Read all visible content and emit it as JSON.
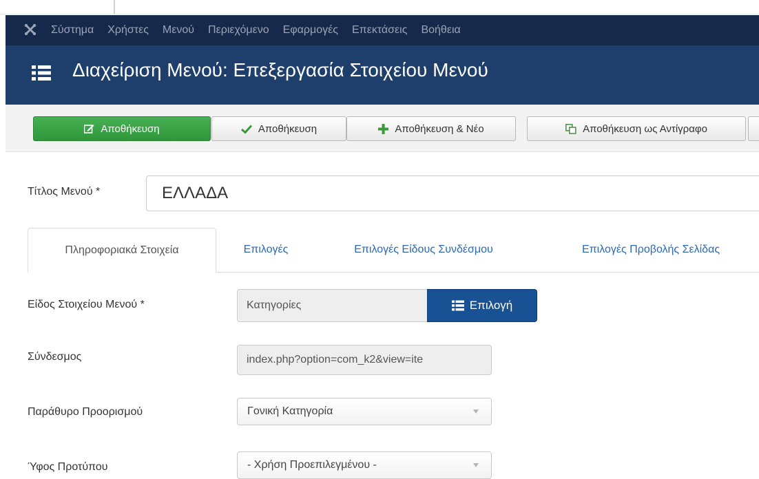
{
  "nav": {
    "logo_icon": "joomla-icon",
    "items": [
      "Σύστημα",
      "Χρήστες",
      "Μενού",
      "Περιεχόμενο",
      "Εφαρμογές",
      "Επεκτάσεις",
      "Βοήθεια"
    ]
  },
  "header": {
    "icon": "list-icon",
    "title": "Διαχείριση Μενού: Επεξεργασία Στοιχείου Μενού"
  },
  "toolbar": {
    "save_label": "Αποθήκευση",
    "save_close_label": "Αποθήκευση",
    "save_new_label": "Αποθήκευση & Νέο",
    "save_copy_label": "Αποθήκευση ως Αντίγραφο"
  },
  "form": {
    "title_label": "Τίτλος Μενού *",
    "title_value": "ΕΛΛΑΔΑ",
    "tabs": [
      "Πληροφοριακά Στοιχεία",
      "Επιλογές",
      "Επιλογές Είδους Συνδέσμου",
      "Επιλογές Προβολής Σελίδας"
    ],
    "active_tab": "Πληροφοριακά Στοιχεία",
    "item_type_label": "Είδος Στοιχείου Μενού *",
    "item_type_value": "Κατηγορίες",
    "select_label": "Επιλογή",
    "link_label": "Σύνδεσμος",
    "link_value": "index.php?option=com_k2&view=ite",
    "target_label": "Παράθυρο Προορισμού",
    "target_value": "Γονική Κατηγορία",
    "template_label": "Ύφος Προτύπου",
    "template_value": "- Χρήση Προεπιλεγμένου -"
  },
  "colors": {
    "navbar": "#17294a",
    "titlebar": "#1e3e6c",
    "primary_button": "#3aa346",
    "select_button": "#195294",
    "tab_link": "#2a69b8"
  }
}
